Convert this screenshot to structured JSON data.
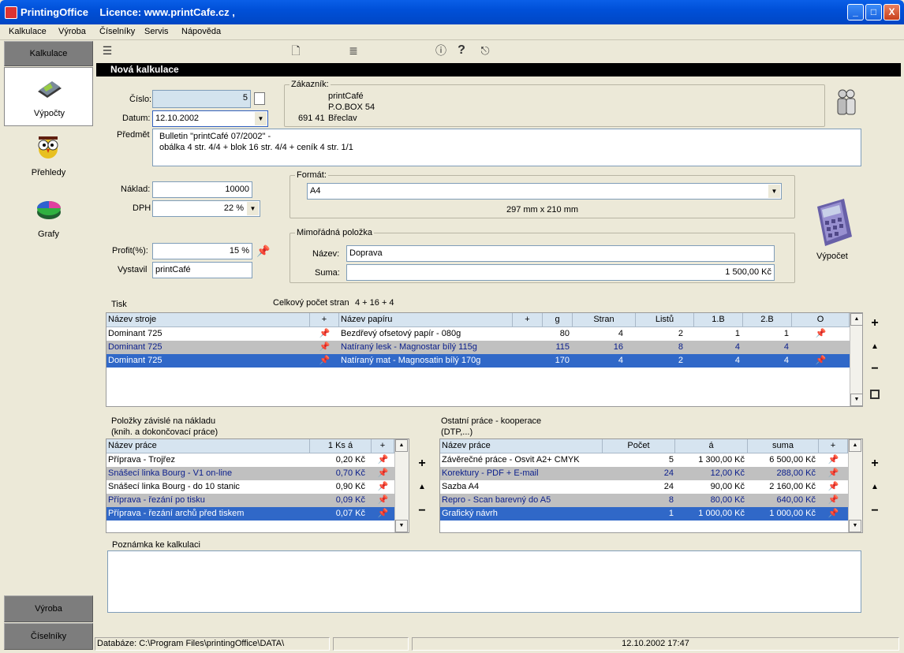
{
  "window": {
    "title": "PrintingOffice    Licence: www.printCafe.cz ,",
    "controls": {
      "min": "_",
      "max": "□",
      "close": "X"
    }
  },
  "menu": [
    "Kalkulace",
    "Výroba",
    "Číselníky",
    "Servis",
    "Nápověda"
  ],
  "sidebar": {
    "header": "Kalkulace",
    "items": [
      {
        "label": "Výpočty",
        "icon": "calculator-book-icon"
      },
      {
        "label": "Přehledy",
        "icon": "owl-icon"
      },
      {
        "label": "Grafy",
        "icon": "pie-chart-icon"
      }
    ],
    "bottom": [
      "Výroba",
      "Číselníky"
    ]
  },
  "toolbar": {
    "icons": [
      "database-icon",
      "new-document-icon",
      "export-icon",
      "info-icon",
      "help-icon",
      "exit-icon"
    ]
  },
  "heading": "Nová kalkulace",
  "form": {
    "cislo_label": "Číslo:",
    "cislo": "5",
    "datum_label": "Datum:",
    "datum": "12.10.2002",
    "predmet_label": "Předmět",
    "predmet_line1": "Bulletin \"printCafé 07/2002\" -",
    "predmet_line2": "obálka 4 str. 4/4 + blok 16 str. 4/4 + ceník 4 str. 1/1",
    "naklad_label": "Náklad:",
    "naklad": "10000",
    "dph_label": "DPH",
    "dph": "22 %",
    "profit_label": "Profit(%):",
    "profit": "15 %",
    "vystavil_label": "Vystavil",
    "vystavil": "printCafé"
  },
  "customer": {
    "title": "Zákazník:",
    "name": "printCafé",
    "box": "P.O.BOX 54",
    "zip": "691 41",
    "city": "Břeclav"
  },
  "format": {
    "title": "Formát:",
    "value": "A4",
    "size": "297 mm x 210 mm"
  },
  "extra": {
    "title": "Mimořádná položka",
    "name_label": "Název:",
    "name": "Doprava",
    "sum_label": "Suma:",
    "sum": "1 500,00 Kč"
  },
  "vypocet": "Výpočet",
  "tisk": {
    "title": "Tisk",
    "pages_label": "Celkový počet stran",
    "pages": "4 + 16 + 4",
    "columns": [
      "Název stroje",
      "+",
      "Název papíru",
      "+",
      "g",
      "Stran",
      "Listů",
      "1.B",
      "2.B",
      "O"
    ],
    "rows": [
      {
        "stroj": "Dominant 725",
        "papir": "Bezdřevý ofsetový papír - 080g",
        "g": "80",
        "stran": "4",
        "listu": "2",
        "b1": "1",
        "b2": "1",
        "o": "pin"
      },
      {
        "stroj": "Dominant 725",
        "papir": "Natíraný lesk - Magnostar bílý 115g",
        "g": "115",
        "stran": "16",
        "listu": "8",
        "b1": "4",
        "b2": "4",
        "o": ""
      },
      {
        "stroj": "Dominant 725",
        "papir": "Natíraný mat - Magnosatin bílý 170g",
        "g": "170",
        "stran": "4",
        "listu": "2",
        "b1": "4",
        "b2": "4",
        "o": "pin"
      }
    ]
  },
  "polozky": {
    "title1": "Položky závislé na nákladu",
    "title2": "(knih. a dokončovací práce)",
    "columns": [
      "Název práce",
      "1 Ks á",
      "+"
    ],
    "rows": [
      {
        "name": "Příprava - Trojřez",
        "price": "0,20 Kč"
      },
      {
        "name": "Snášecí linka Bourg - V1 on-line",
        "price": "0,70 Kč"
      },
      {
        "name": "Snášecí linka Bourg - do 10 stanic",
        "price": "0,90 Kč"
      },
      {
        "name": "Příprava - řezání po tisku",
        "price": "0,09 Kč"
      },
      {
        "name": "Příprava - řezání archů před tiskem",
        "price": "0,07 Kč"
      }
    ]
  },
  "ostatni": {
    "title1": "Ostatní práce - kooperace",
    "title2": "(DTP,...)",
    "columns": [
      "Název práce",
      "Počet",
      "á",
      "suma",
      "+"
    ],
    "rows": [
      {
        "name": "Závěrečné práce - Osvit A2+ CMYK",
        "pocet": "5",
        "a": "1 300,00 Kč",
        "suma": "6 500,00 Kč"
      },
      {
        "name": "Korektury - PDF + E-mail",
        "pocet": "24",
        "a": "12,00 Kč",
        "suma": "288,00 Kč"
      },
      {
        "name": "Sazba A4",
        "pocet": "24",
        "a": "90,00 Kč",
        "suma": "2 160,00 Kč"
      },
      {
        "name": "Repro - Scan barevný do A5",
        "pocet": "8",
        "a": "80,00 Kč",
        "suma": "640,00 Kč"
      },
      {
        "name": "Grafický návrh",
        "pocet": "1",
        "a": "1 000,00 Kč",
        "suma": "1 000,00 Kč"
      }
    ]
  },
  "poznamka": "Poznámka ke kalkulaci",
  "status": {
    "db": "Databáze: C:\\Program Files\\printingOffice\\DATA\\",
    "datetime": "12.10.2002 17:47"
  }
}
